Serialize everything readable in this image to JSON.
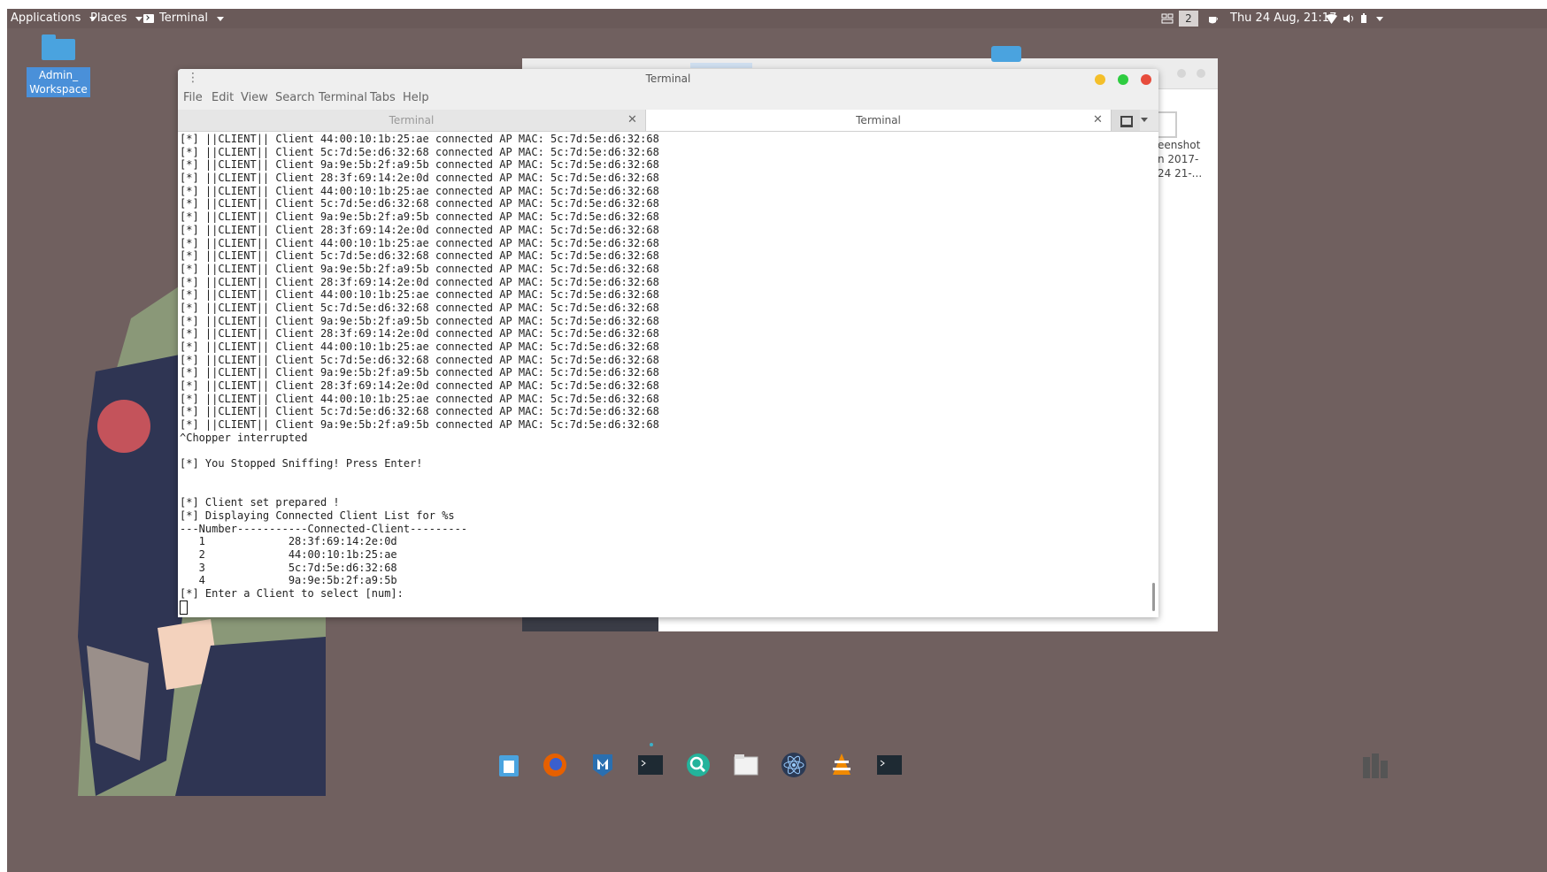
{
  "top_panel": {
    "applications_label": "Applications",
    "places_label": "Places",
    "terminal_label": "Terminal",
    "workspace_number": "2",
    "clock": "Thu 24 Aug, 21:17"
  },
  "desktop": {
    "icon_label_line1": "Admin_",
    "icon_label_line2": "Workspace",
    "background_window": {
      "file_label_line1": "eenshot",
      "file_label_line2": "n 2017-",
      "file_label_line3": "24 21-..."
    }
  },
  "terminal_window": {
    "title": "Terminal",
    "menu": [
      "File",
      "Edit",
      "View",
      "Search",
      "Terminal",
      "Tabs",
      "Help"
    ],
    "tabs": [
      {
        "label": "Terminal",
        "active": false
      },
      {
        "label": "Terminal",
        "active": true
      }
    ],
    "output_lines": [
      "[*] ||CLIENT|| Client 44:00:10:1b:25:ae connected AP MAC: 5c:7d:5e:d6:32:68",
      "[*] ||CLIENT|| Client 5c:7d:5e:d6:32:68 connected AP MAC: 5c:7d:5e:d6:32:68",
      "[*] ||CLIENT|| Client 9a:9e:5b:2f:a9:5b connected AP MAC: 5c:7d:5e:d6:32:68",
      "[*] ||CLIENT|| Client 28:3f:69:14:2e:0d connected AP MAC: 5c:7d:5e:d6:32:68",
      "[*] ||CLIENT|| Client 44:00:10:1b:25:ae connected AP MAC: 5c:7d:5e:d6:32:68",
      "[*] ||CLIENT|| Client 5c:7d:5e:d6:32:68 connected AP MAC: 5c:7d:5e:d6:32:68",
      "[*] ||CLIENT|| Client 9a:9e:5b:2f:a9:5b connected AP MAC: 5c:7d:5e:d6:32:68",
      "[*] ||CLIENT|| Client 28:3f:69:14:2e:0d connected AP MAC: 5c:7d:5e:d6:32:68",
      "[*] ||CLIENT|| Client 44:00:10:1b:25:ae connected AP MAC: 5c:7d:5e:d6:32:68",
      "[*] ||CLIENT|| Client 5c:7d:5e:d6:32:68 connected AP MAC: 5c:7d:5e:d6:32:68",
      "[*] ||CLIENT|| Client 9a:9e:5b:2f:a9:5b connected AP MAC: 5c:7d:5e:d6:32:68",
      "[*] ||CLIENT|| Client 28:3f:69:14:2e:0d connected AP MAC: 5c:7d:5e:d6:32:68",
      "[*] ||CLIENT|| Client 44:00:10:1b:25:ae connected AP MAC: 5c:7d:5e:d6:32:68",
      "[*] ||CLIENT|| Client 5c:7d:5e:d6:32:68 connected AP MAC: 5c:7d:5e:d6:32:68",
      "[*] ||CLIENT|| Client 9a:9e:5b:2f:a9:5b connected AP MAC: 5c:7d:5e:d6:32:68",
      "[*] ||CLIENT|| Client 28:3f:69:14:2e:0d connected AP MAC: 5c:7d:5e:d6:32:68",
      "[*] ||CLIENT|| Client 44:00:10:1b:25:ae connected AP MAC: 5c:7d:5e:d6:32:68",
      "[*] ||CLIENT|| Client 5c:7d:5e:d6:32:68 connected AP MAC: 5c:7d:5e:d6:32:68",
      "[*] ||CLIENT|| Client 9a:9e:5b:2f:a9:5b connected AP MAC: 5c:7d:5e:d6:32:68",
      "[*] ||CLIENT|| Client 28:3f:69:14:2e:0d connected AP MAC: 5c:7d:5e:d6:32:68",
      "[*] ||CLIENT|| Client 44:00:10:1b:25:ae connected AP MAC: 5c:7d:5e:d6:32:68",
      "[*] ||CLIENT|| Client 5c:7d:5e:d6:32:68 connected AP MAC: 5c:7d:5e:d6:32:68",
      "[*] ||CLIENT|| Client 9a:9e:5b:2f:a9:5b connected AP MAC: 5c:7d:5e:d6:32:68",
      "^Chopper interrupted",
      "",
      "[*] You Stopped Sniffing! Press Enter!",
      "",
      "",
      "[*] Client set prepared !",
      "[*] Displaying Connected Client List for %s",
      "---Number-----------Connected-Client---------",
      "   1             28:3f:69:14:2e:0d",
      "   2             44:00:10:1b:25:ae",
      "   3             5c:7d:5e:d6:32:68",
      "   4             9a:9e:5b:2f:a9:5b",
      "[*] Enter a Client to select [num]:"
    ]
  },
  "dock": {
    "items": [
      "files-icon",
      "firefox-icon",
      "metasploit-icon",
      "terminal-icon",
      "search-icon",
      "file-manager-icon",
      "atom-icon",
      "vlc-icon",
      "terminal-icon-2"
    ]
  },
  "colors": {
    "desktop_bg": "#70605f",
    "panel_bg": "#6a5a59",
    "close_red": "#e74c3c",
    "maximize_green": "#2ecc40",
    "minimize_yellow": "#f4bf2a"
  }
}
